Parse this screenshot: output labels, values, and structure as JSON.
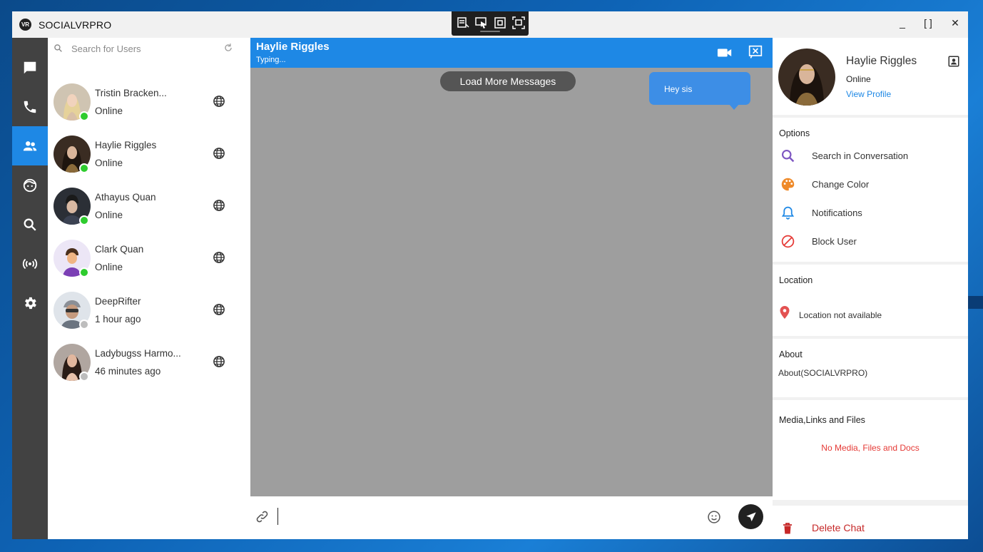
{
  "window": {
    "title": "SOCIALVRPRO",
    "logo_text": "VR",
    "minimize": "_",
    "maximize": "[ ]",
    "close": "✕"
  },
  "colors": {
    "accent": "#1e88e5",
    "rail": "#424242",
    "chat_bg": "#9e9e9e",
    "online": "#2ecc2e",
    "offline": "#bdbdbd",
    "danger": "#c62828"
  },
  "rail": {
    "items": [
      {
        "icon": "chat-icon",
        "active": false
      },
      {
        "icon": "phone-icon",
        "active": false
      },
      {
        "icon": "people-icon",
        "active": true
      },
      {
        "icon": "face-icon",
        "active": false
      },
      {
        "icon": "search-icon",
        "active": false
      },
      {
        "icon": "broadcast-icon",
        "active": false
      },
      {
        "icon": "gear-icon",
        "active": false
      }
    ]
  },
  "userlist": {
    "search_placeholder": "Search for Users",
    "users": [
      {
        "name": "Tristin Bracken...",
        "status": "Online",
        "online": true
      },
      {
        "name": "Haylie Riggles",
        "status": "Online",
        "online": true
      },
      {
        "name": "Athayus Quan",
        "status": "Online",
        "online": true
      },
      {
        "name": "Clark Quan",
        "status": "Online",
        "online": true
      },
      {
        "name": "DeepRifter",
        "status": "1 hour ago",
        "online": false
      },
      {
        "name": "Ladybugss Harmo...",
        "status": "46 minutes ago",
        "online": false
      }
    ]
  },
  "chat": {
    "contact_name": "Haylie Riggles",
    "typing": "Typing...",
    "load_more": "Load More Messages",
    "messages": [
      {
        "text": "Hey sis",
        "outgoing": true
      }
    ],
    "input_value": ""
  },
  "profile": {
    "name": "Haylie Riggles",
    "status": "Online",
    "view_profile": "View Profile",
    "options_title": "Options",
    "options": [
      {
        "icon": "search-icon",
        "label": "Search in Conversation",
        "color": "#7e57c2"
      },
      {
        "icon": "palette-icon",
        "label": "Change Color",
        "color": "#ef8a2a"
      },
      {
        "icon": "bell-icon",
        "label": "Notifications",
        "color": "#1e88e5"
      },
      {
        "icon": "block-icon",
        "label": "Block User",
        "color": "#e53935"
      }
    ],
    "location_title": "Location",
    "location_text": "Location not available",
    "about_title": "About",
    "about_text": "About(SOCIALVRPRO)",
    "media_title": "Media,Links and Files",
    "media_empty": "No Media, Files and Docs",
    "delete_label": "Delete Chat"
  }
}
